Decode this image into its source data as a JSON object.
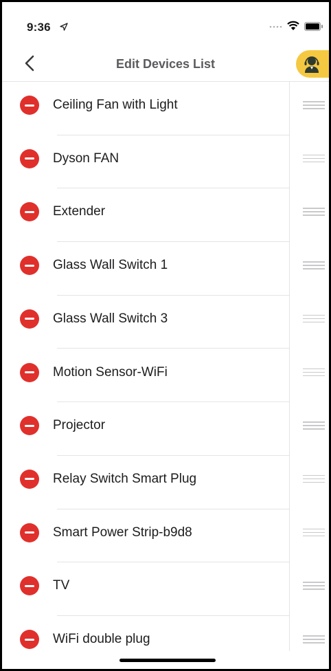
{
  "status_bar": {
    "time": "9:36",
    "icons": [
      "location-arrow-icon",
      "cellular-dots-icon",
      "wifi-icon",
      "battery-icon"
    ]
  },
  "nav": {
    "title": "Edit Devices List",
    "back_icon": "chevron-left-icon",
    "profile_icon": "support-agent-icon",
    "profile_color": "#f5c842"
  },
  "colors": {
    "delete": "#e0302c",
    "separator": "#e4e4e6",
    "title_text": "#5b5b5f"
  },
  "devices": [
    "Ceiling Fan with Light",
    "Dyson FAN",
    "Extender",
    "Glass Wall Switch 1",
    "Glass Wall Switch 3",
    "Motion Sensor-WiFi",
    "Projector",
    "Relay Switch Smart Plug",
    "Smart Power Strip-b9d8",
    "TV",
    "WiFi double plug"
  ]
}
